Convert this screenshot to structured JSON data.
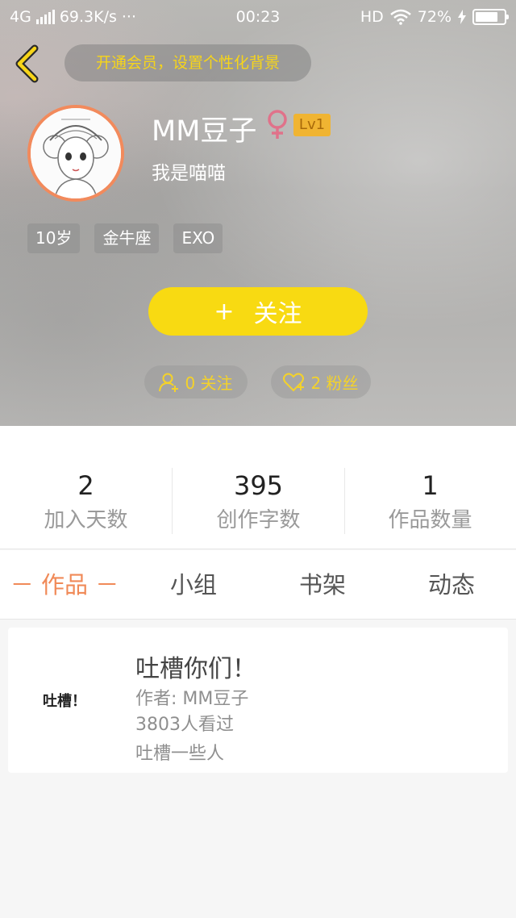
{
  "status_bar": {
    "network": "4G",
    "speed": "69.3K/s",
    "dots": "···",
    "time": "00:23",
    "hd": "HD",
    "battery": "72%"
  },
  "header": {
    "vip_banner": "开通会员，设置个性化背景"
  },
  "profile": {
    "username": "MM豆子",
    "gender": "♀",
    "level": "Lv1",
    "signature": "我是喵喵",
    "tags": [
      "10岁",
      "金牛座",
      "EXO"
    ],
    "follow_label": "关注",
    "follow_plus": "+",
    "following": "0 关注",
    "fans": "2 粉丝"
  },
  "stats": [
    {
      "value": "2",
      "label": "加入天数"
    },
    {
      "value": "395",
      "label": "创作字数"
    },
    {
      "value": "1",
      "label": "作品数量"
    }
  ],
  "tabs": [
    {
      "label": "－ 作品 －"
    },
    {
      "label": "小组"
    },
    {
      "label": "书架"
    },
    {
      "label": "动态"
    }
  ],
  "works": [
    {
      "cover_text": "吐槽！",
      "title": "吐槽你们！",
      "author": "作者: MM豆子",
      "views": "3803人看过",
      "description": "吐槽一些人"
    }
  ],
  "colors": {
    "accent_yellow": "#f8da12",
    "accent_orange": "#f08a58",
    "level_badge": "#f0b432"
  }
}
